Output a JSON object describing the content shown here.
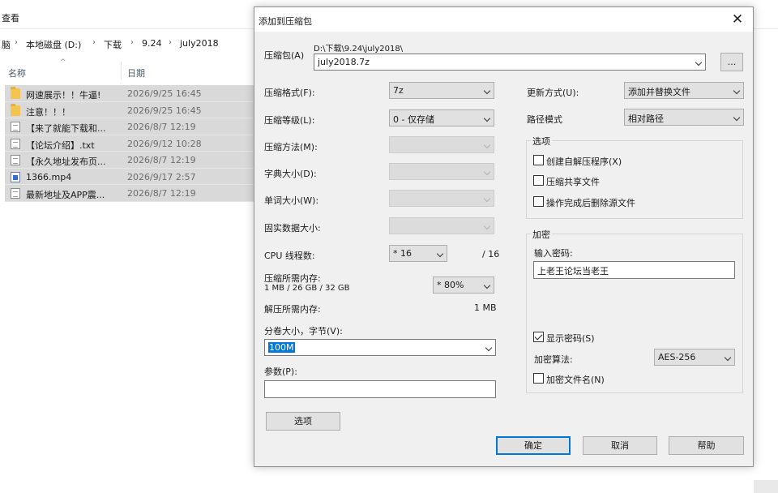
{
  "explorer": {
    "ribbon_tab": "查看",
    "breadcrumb": {
      "lead": "脑",
      "items": [
        "本地磁盘 (D:)",
        "下载",
        "9.24",
        "july2018"
      ]
    },
    "columns": {
      "name": "名称",
      "date": "日期"
    },
    "files": [
      {
        "icon": "folder-icon",
        "name": "网速展示！！牛逼!",
        "date": "2026/9/25 16:45"
      },
      {
        "icon": "folder-icon",
        "name": "注意！！！",
        "date": "2026/9/25 16:45"
      },
      {
        "icon": "document-icon",
        "name": "【来了就能下载和...",
        "date": "2026/8/7 12:19"
      },
      {
        "icon": "document-icon",
        "name": "【论坛介绍】.txt",
        "date": "2026/9/12 10:28"
      },
      {
        "icon": "document-icon",
        "name": "【永久地址发布页...",
        "date": "2026/8/7 12:19"
      },
      {
        "icon": "video-icon",
        "name": "1366.mp4",
        "date": "2026/9/17 2:57"
      },
      {
        "icon": "document-icon",
        "name": "最新地址及APP震...",
        "date": "2026/8/7 12:19"
      }
    ]
  },
  "dialog": {
    "title": "添加到压缩包",
    "close_glyph": "✕",
    "archive": {
      "label": "压缩包(A)",
      "path": "D:\\下载\\9.24\\july2018\\",
      "name": "july2018.7z",
      "browse_label": "..."
    },
    "left": {
      "format_label": "压缩格式(F):",
      "format_value": "7z",
      "level_label": "压缩等级(L):",
      "level_value": "0 - 仅存储",
      "method_label": "压缩方法(M):",
      "dict_label": "字典大小(D):",
      "word_label": "单词大小(W):",
      "solid_label": "固实数据大小:",
      "cpu_label": "CPU 线程数:",
      "cpu_value": "* 16",
      "cpu_max": "/ 16",
      "mem_comp_label": "压缩所需内存:",
      "mem_comp_detail": "1 MB / 26 GB / 32 GB",
      "mem_comp_value": "* 80%",
      "mem_decomp_label": "解压所需内存:",
      "mem_decomp_value": "1 MB",
      "split_label": "分卷大小，字节(V):",
      "split_value": "100M",
      "params_label": "参数(P):",
      "params_value": "",
      "options_button": "选项"
    },
    "right": {
      "update_label": "更新方式(U):",
      "update_value": "添加并替换文件",
      "path_label": "路径模式",
      "path_value": "相对路径",
      "options_group": "选项",
      "opt_sfx": "创建自解压程序(X)",
      "opt_shared": "压缩共享文件",
      "opt_delete": "操作完成后删除源文件",
      "enc_group": "加密",
      "password_label": "输入密码:",
      "password_value": "上老王论坛当老王",
      "show_password": "显示密码(S)",
      "enc_method_label": "加密算法:",
      "enc_method_value": "AES-256",
      "enc_names": "加密文件名(N)"
    },
    "buttons": {
      "ok": "确定",
      "cancel": "取消",
      "help": "帮助"
    }
  }
}
